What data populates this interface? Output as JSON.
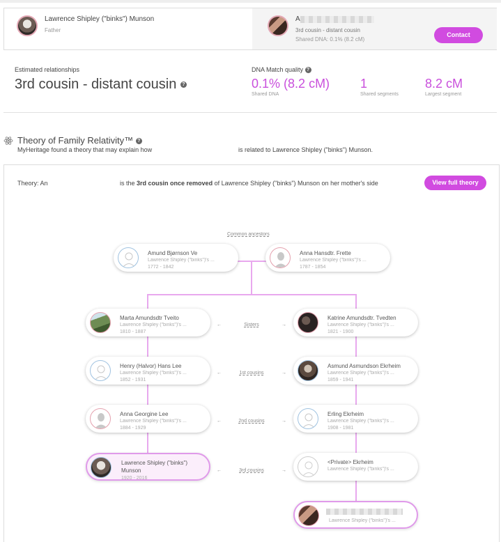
{
  "match": {
    "left": {
      "name": "Lawrence Shipley (\"binks\") Munson",
      "relation": "Father"
    },
    "right": {
      "initial": "A",
      "relationship": "3rd cousin - distant cousin",
      "shared_dna": "Shared DNA: 0.1% (8.2 cM)",
      "contact_label": "Contact"
    }
  },
  "estimated": {
    "label": "Estimated relationships",
    "value": "3rd cousin - distant cousin",
    "info": "?"
  },
  "dna_quality": {
    "label": "DNA Match quality",
    "info": "?",
    "shared_pct": "0.1%",
    "shared_cm": "(8.2 cM)",
    "shared_label": "Shared DNA",
    "segments": "1",
    "segments_label": "Shared segments",
    "largest": "8.2 cM",
    "largest_label": "Largest segment"
  },
  "theory": {
    "title": "Theory of Family Relativity™",
    "info": "?",
    "desc_a": "MyHeritage found a theory that may explain how",
    "desc_b": "is related to Lawrence Shipley (\"binks\") Munson.",
    "line_a": "Theory: An",
    "line_b": "is the",
    "line_bold": "3rd cousin once removed",
    "line_c": "of Lawrence Shipley (\"binks\") Munson on her mother's side",
    "view_label": "View full theory"
  },
  "tree": {
    "common_label": "Common ancestors",
    "arrow_left": "←",
    "arrow_right": "→",
    "ancestors": [
      {
        "name": "Amund Bjørnson Ve",
        "sub": "Lawrence Shipley (\"binks\")'s ...",
        "years": "1772 - 1842"
      },
      {
        "name": "Anna Hansdtr. Frette",
        "sub": "Lawrence Shipley (\"binks\")'s ...",
        "years": "1787 - 1854"
      }
    ],
    "rows": [
      {
        "rel": "Sisters",
        "left": {
          "name": "Marta Amundsdtr Tveito",
          "sub": "Lawrence Shipley (\"binks\")'s ...",
          "years": "1810 - 1887"
        },
        "right": {
          "name": "Katrine Amundsdtr. Tvedten",
          "sub": "Lawrence Shipley (\"binks\")'s ...",
          "years": "1821 - 1900"
        }
      },
      {
        "rel": "1st cousins",
        "left": {
          "name": "Henry (Halvor) Hans Lee",
          "sub": "Lawrence Shipley (\"binks\")'s ...",
          "years": "1852 - 1931"
        },
        "right": {
          "name": "Asmund Asmundson Ekrheim",
          "sub": "Lawrence Shipley (\"binks\")'s ...",
          "years": "1859 - 1941"
        }
      },
      {
        "rel": "2nd cousins",
        "left": {
          "name": "Anna Georgine Lee",
          "sub": "Lawrence Shipley (\"binks\")'s ...",
          "years": "1884 - 1929"
        },
        "right": {
          "name": "Erling Ekrheim",
          "sub": "Lawrence Shipley (\"binks\")'s ...",
          "years": "1908 - 1981"
        }
      },
      {
        "rel": "3rd cousins",
        "left": {
          "name": "Lawrence Shipley (\"binks\")",
          "name2": "Munson",
          "years": "1920 - 2016"
        },
        "right": {
          "name": "<Private> Ekrheim",
          "sub": "Lawrence Shipley (\"binks\")'s ..."
        }
      }
    ],
    "match_person": {
      "sub": "Lawrence Shipley (\"binks\")'s ..."
    }
  },
  "colors": {
    "accent": "#d14be0",
    "dna": "#c94fdc",
    "connector": "#e8a8ee"
  }
}
